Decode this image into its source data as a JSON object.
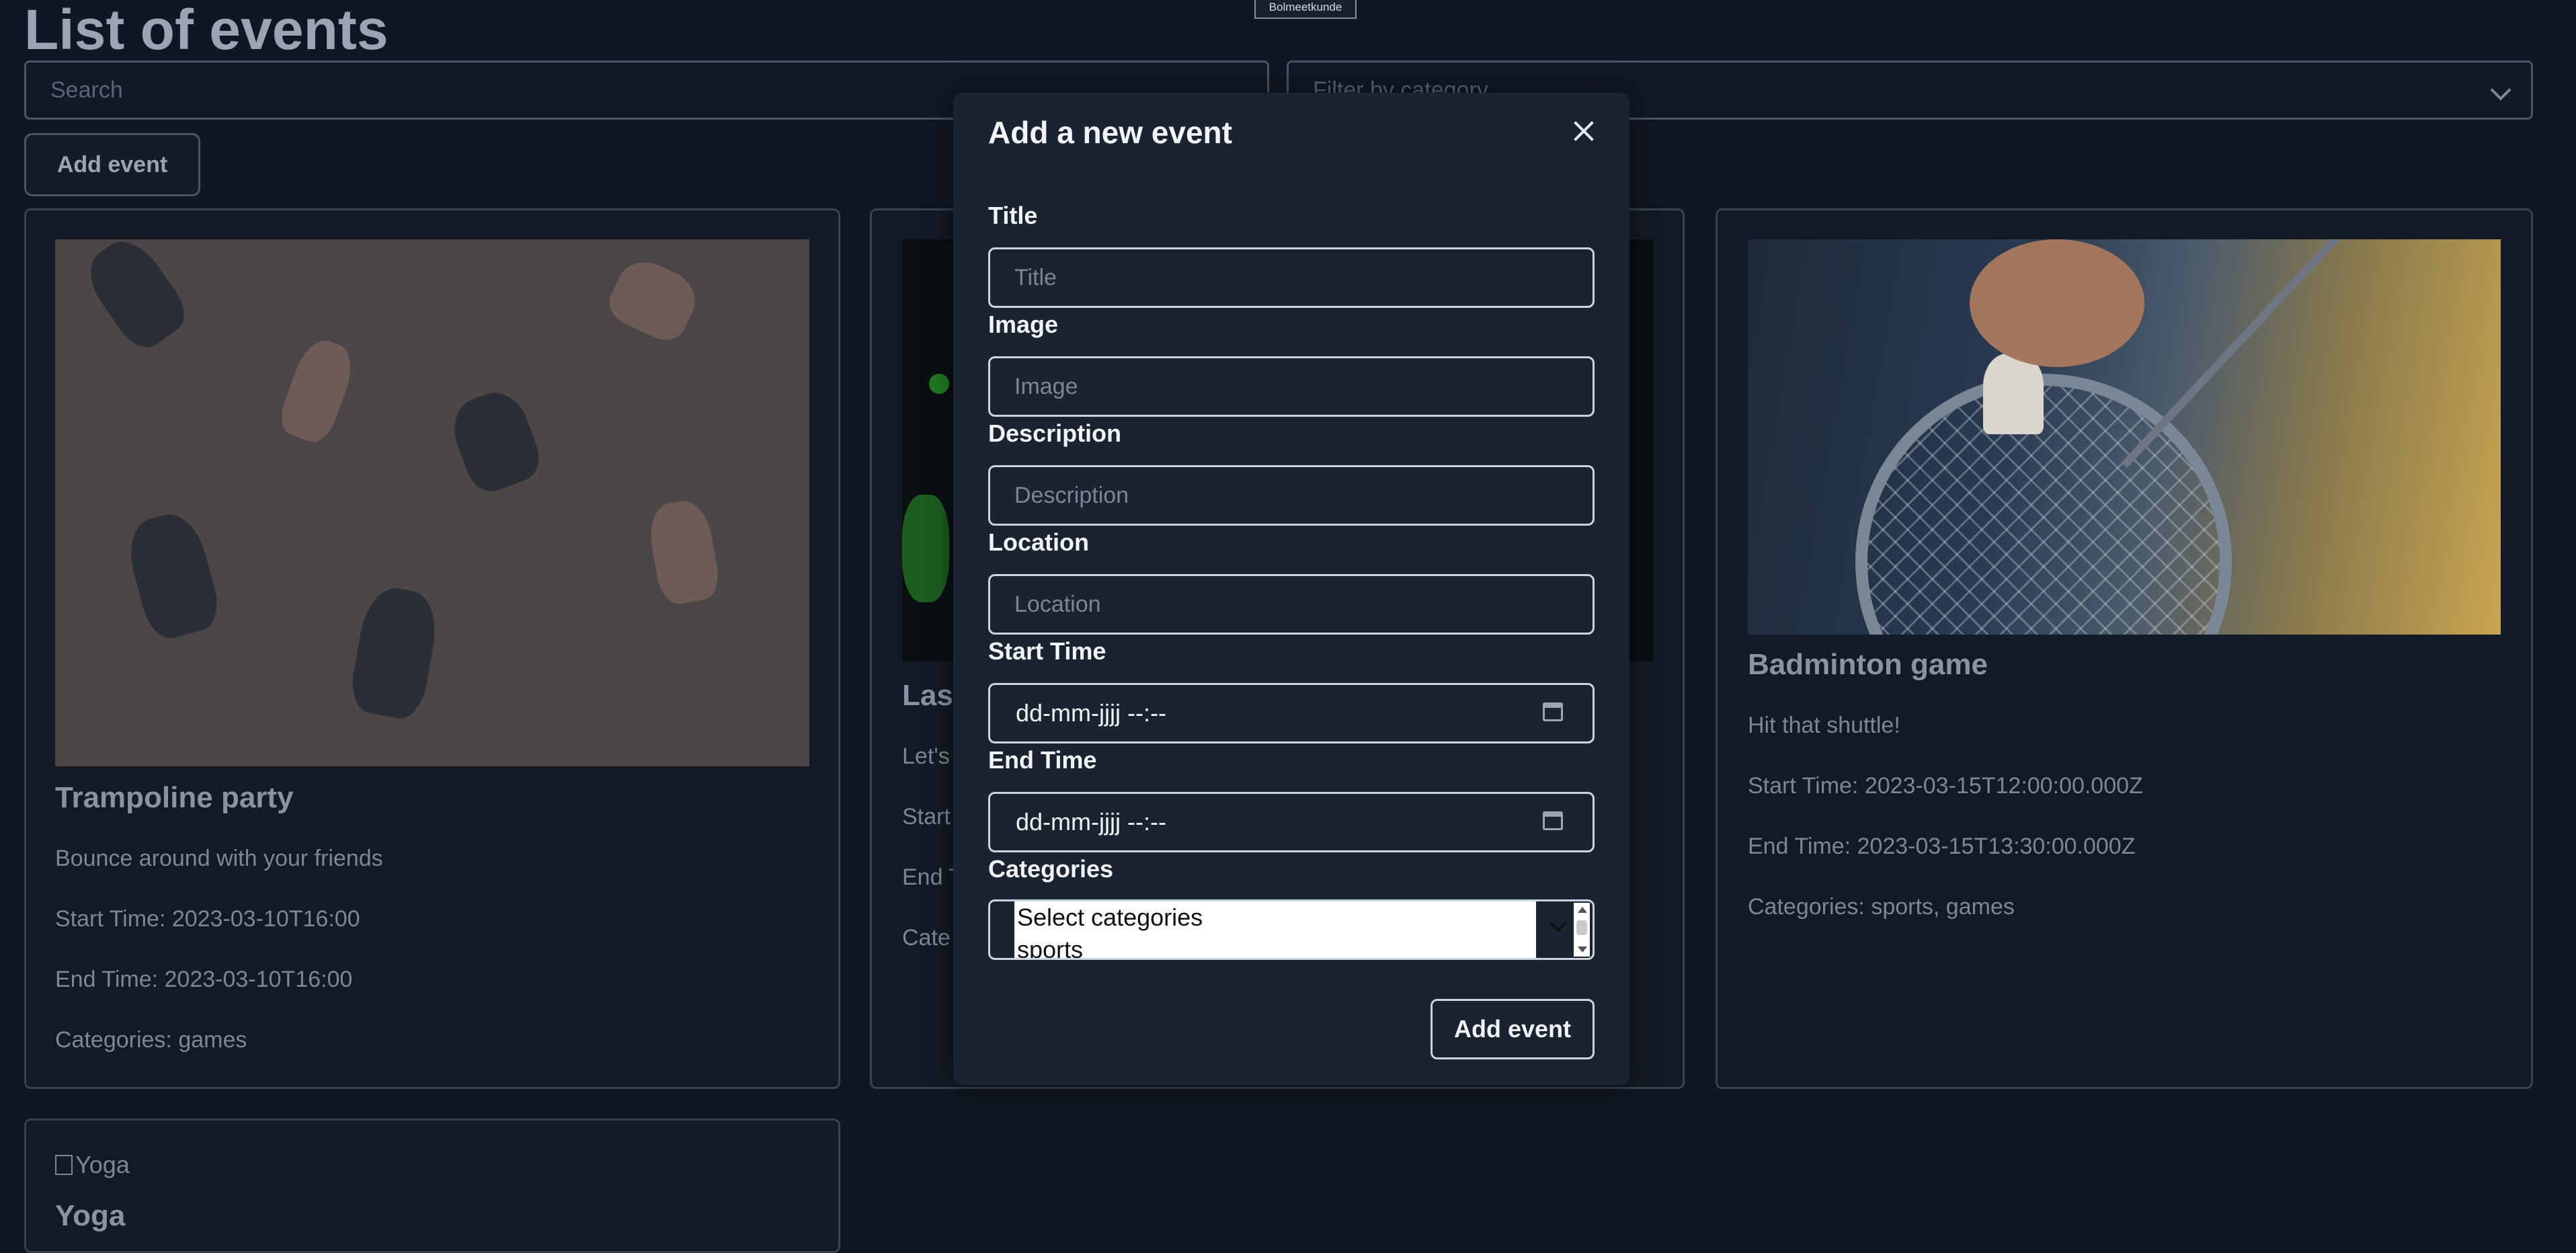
{
  "page": {
    "title": "List of events",
    "tooltip": "Bolmeetkunde",
    "search_placeholder": "Search",
    "filter_placeholder": "Filter by category",
    "add_button": "Add event"
  },
  "events": [
    {
      "title": "Trampoline party",
      "description": "Bounce around with your friends",
      "start": "Start Time: 2023-03-10T16:00",
      "end": "End Time: 2023-03-10T16:00",
      "categories": "Categories: games"
    },
    {
      "title": "Lase",
      "description": "Let's",
      "start": "Start",
      "end": "End T",
      "categories": "Cate"
    },
    {
      "title": "Badminton game",
      "description": "Hit that shuttle!",
      "start": "Start Time: 2023-03-15T12:00:00.000Z",
      "end": "End Time: 2023-03-15T13:30:00.000Z",
      "categories": "Categories: sports, games"
    },
    {
      "image_alt": "Yoga",
      "title": "Yoga"
    }
  ],
  "modal": {
    "title": "Add a new event",
    "fields": {
      "title_label": "Title",
      "title_placeholder": "Title",
      "image_label": "Image",
      "image_placeholder": "Image",
      "description_label": "Description",
      "description_placeholder": "Description",
      "location_label": "Location",
      "location_placeholder": "Location",
      "start_label": "Start Time",
      "start_value": "dd-mm-jjjj --:--",
      "end_label": "End Time",
      "end_value": "dd-mm-jjjj --:--",
      "categories_label": "Categories",
      "categories_options": [
        "Select categories",
        "sports"
      ]
    },
    "submit": "Add event"
  }
}
